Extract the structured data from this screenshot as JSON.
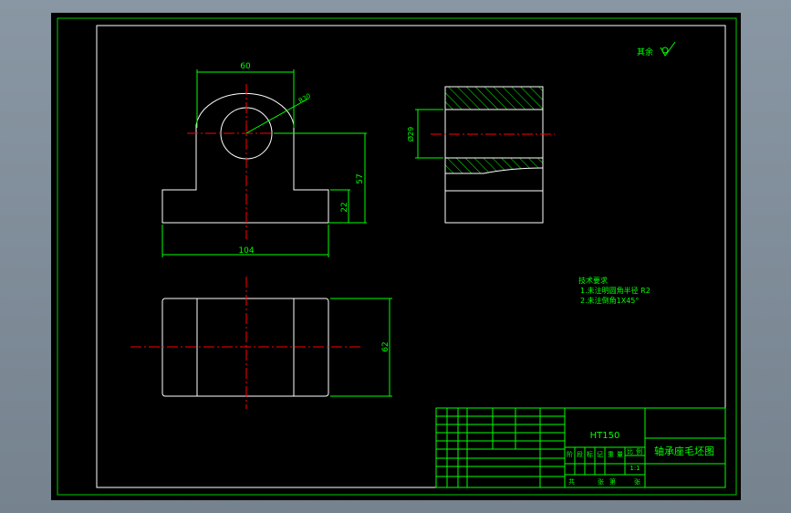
{
  "colors": {
    "background": "#000000",
    "frame": "#ffffff",
    "dimension": "#00ff00",
    "centerline": "#ff0000",
    "hatch": "#00ff00",
    "text": "#00ff00",
    "outer_border": "#00cc00"
  },
  "dimensions": {
    "top_width": "60",
    "radius": "R30",
    "height_57": "57",
    "height_22": "22",
    "base_width": "104",
    "bore_dia": "Ø29",
    "depth_62": "62"
  },
  "roughness_note": "其余",
  "tech_requirements": {
    "title": "技术要求",
    "item1": "1.未注明圆角半径 R2",
    "item2": "2.未注倒角1X45°"
  },
  "title_block": {
    "material": "HT150",
    "drawing_name": "轴承座毛坯图",
    "scale": "1:1",
    "col_labels": [
      "阶",
      "段",
      "标",
      "记",
      "重",
      "量",
      "比",
      "例"
    ],
    "sheet_text": [
      "共",
      "张",
      "第",
      "张"
    ]
  }
}
